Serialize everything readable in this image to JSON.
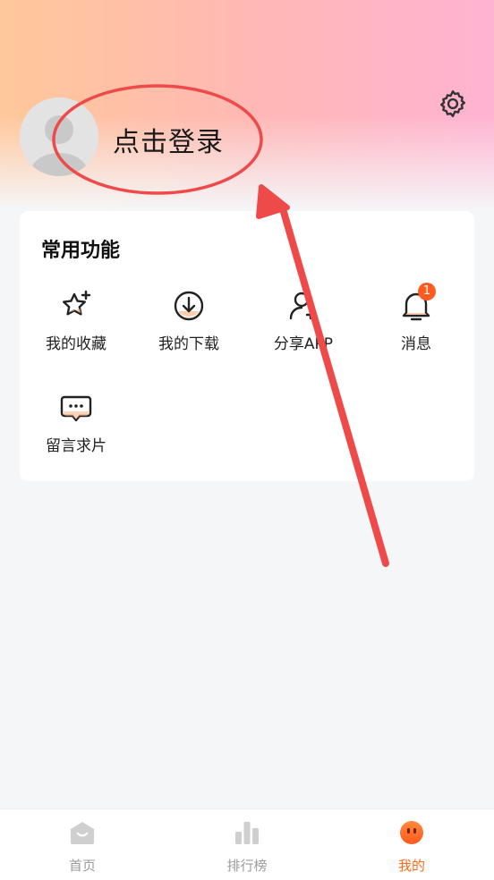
{
  "header": {
    "login_label": "点击登录"
  },
  "common": {
    "title": "常用功能",
    "items": [
      {
        "label": "我的收藏",
        "icon": "star-icon"
      },
      {
        "label": "我的下载",
        "icon": "download-icon"
      },
      {
        "label": "分享APP",
        "icon": "share-user-icon"
      },
      {
        "label": "消息",
        "icon": "bell-icon",
        "badge": "1"
      },
      {
        "label": "留言求片",
        "icon": "message-icon"
      }
    ]
  },
  "tabbar": {
    "items": [
      {
        "label": "首页",
        "icon": "home-icon"
      },
      {
        "label": "排行榜",
        "icon": "ranking-icon"
      },
      {
        "label": "我的",
        "icon": "me-icon"
      }
    ],
    "active_color": "#ff6b1a"
  },
  "colors": {
    "accent": "#ff6b1a",
    "annotation": "#ee4a4a"
  }
}
